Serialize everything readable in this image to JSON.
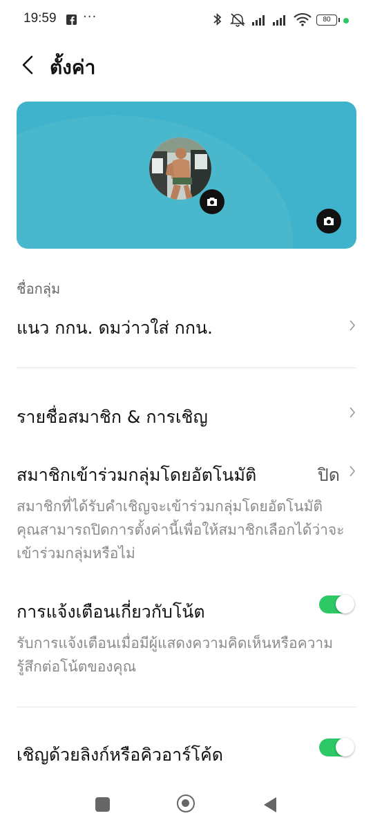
{
  "status_bar": {
    "time": "19:59",
    "more": "···",
    "battery": "80",
    "icons": [
      "facebook-icon",
      "bluetooth-icon",
      "mute-icon",
      "signal-icon",
      "signal-icon",
      "wifi-icon",
      "battery-icon"
    ]
  },
  "header": {
    "title": "ตั้งค่า"
  },
  "group": {
    "name_label": "ชื่อกลุ่ม",
    "name_value": "แนว กกน. ดมว่าวใส่ กกน."
  },
  "settings": {
    "members": {
      "title": "รายชื่อสมาชิก & การเชิญ"
    },
    "auto_join": {
      "title": "สมาชิกเข้าร่วมกลุ่มโดยอัตโนมัติ",
      "value": "ปิด",
      "desc": "สมาชิกที่ได้รับคำเชิญจะเข้าร่วมกลุ่มโดยอัตโนมัติ คุณสามารถปิดการตั้งค่านี้เพื่อให้สมาชิกเลือกได้ว่าจะเข้าร่วมกลุ่มหรือไม่"
    },
    "note_notify": {
      "title": "การแจ้งเตือนเกี่ยวกับโน้ต",
      "desc": "รับการแจ้งเตือนเมื่อมีผู้แสดงความคิดเห็นหรือความรู้สึกต่อโน้ตของคุณ",
      "enabled": true
    },
    "invite_link": {
      "title": "เชิญด้วยลิงก์หรือคิวอาร์โค้ด",
      "enabled": true
    }
  },
  "colors": {
    "cover": "#3fb3cb",
    "toggle_on": "#2ec866"
  }
}
